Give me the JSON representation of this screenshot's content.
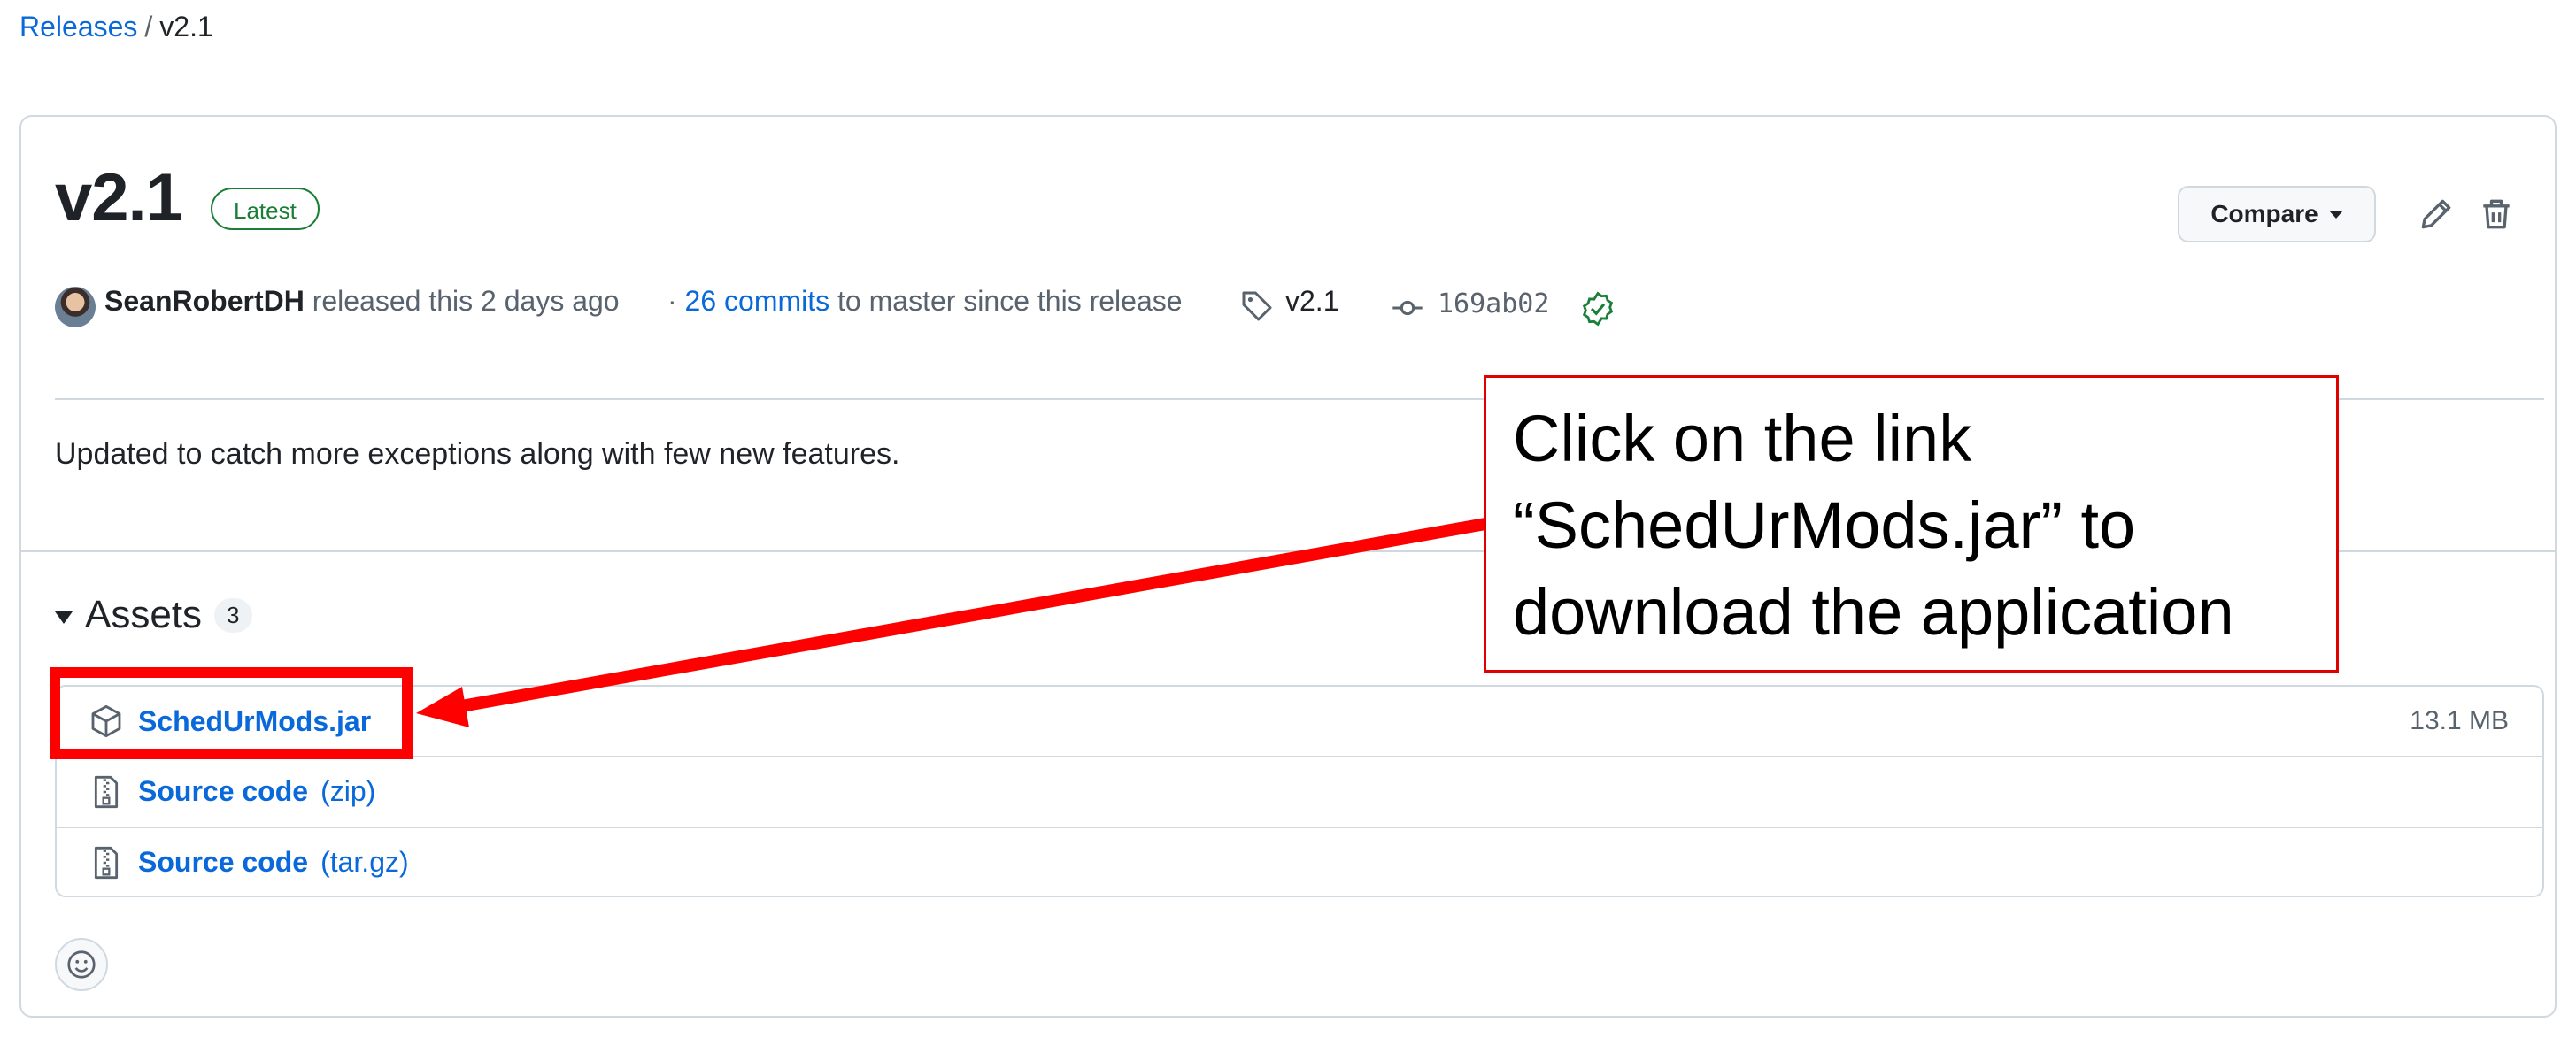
{
  "breadcrumb": {
    "parent": "Releases",
    "separator": "/",
    "current": "v2.1"
  },
  "release": {
    "title": "v2.1",
    "badge": "Latest",
    "compare_label": "Compare",
    "author": "SeanRobertDH",
    "released_text": "released this 2 days ago",
    "commits_prefix": "·",
    "commits_link": "26 commits",
    "commits_suffix": "to master since this release",
    "tag": "v2.1",
    "commit_hash": "169ab02",
    "description": "Updated to catch more exceptions along with few new features."
  },
  "assets": {
    "heading": "Assets",
    "count": "3",
    "items": [
      {
        "name": "SchedUrMods.jar",
        "ext": "",
        "size": "13.1 MB",
        "icon": "package-icon"
      },
      {
        "name": "Source code",
        "ext": "(zip)",
        "size": "",
        "icon": "file-zip-icon"
      },
      {
        "name": "Source code",
        "ext": "(tar.gz)",
        "size": "",
        "icon": "file-zip-icon"
      }
    ]
  },
  "annotation": {
    "callout_lines": [
      "Click on the link",
      "“SchedUrMods.jar” to",
      "download the application"
    ],
    "color": "#ff0000"
  },
  "colors": {
    "link": "#0969da",
    "success": "#1a7f37",
    "border": "#d1d9e0"
  }
}
